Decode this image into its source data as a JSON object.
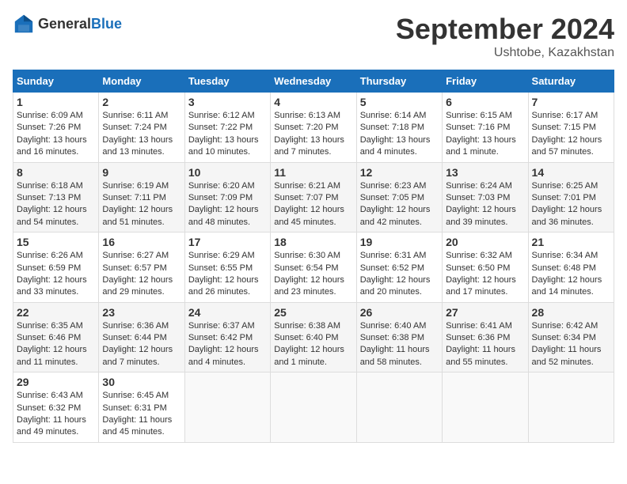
{
  "header": {
    "logo_general": "General",
    "logo_blue": "Blue",
    "month": "September 2024",
    "location": "Ushtobe, Kazakhstan"
  },
  "weekdays": [
    "Sunday",
    "Monday",
    "Tuesday",
    "Wednesday",
    "Thursday",
    "Friday",
    "Saturday"
  ],
  "weeks": [
    [
      {
        "day": "1",
        "sunrise": "Sunrise: 6:09 AM",
        "sunset": "Sunset: 7:26 PM",
        "daylight": "Daylight: 13 hours and 16 minutes."
      },
      {
        "day": "2",
        "sunrise": "Sunrise: 6:11 AM",
        "sunset": "Sunset: 7:24 PM",
        "daylight": "Daylight: 13 hours and 13 minutes."
      },
      {
        "day": "3",
        "sunrise": "Sunrise: 6:12 AM",
        "sunset": "Sunset: 7:22 PM",
        "daylight": "Daylight: 13 hours and 10 minutes."
      },
      {
        "day": "4",
        "sunrise": "Sunrise: 6:13 AM",
        "sunset": "Sunset: 7:20 PM",
        "daylight": "Daylight: 13 hours and 7 minutes."
      },
      {
        "day": "5",
        "sunrise": "Sunrise: 6:14 AM",
        "sunset": "Sunset: 7:18 PM",
        "daylight": "Daylight: 13 hours and 4 minutes."
      },
      {
        "day": "6",
        "sunrise": "Sunrise: 6:15 AM",
        "sunset": "Sunset: 7:16 PM",
        "daylight": "Daylight: 13 hours and 1 minute."
      },
      {
        "day": "7",
        "sunrise": "Sunrise: 6:17 AM",
        "sunset": "Sunset: 7:15 PM",
        "daylight": "Daylight: 12 hours and 57 minutes."
      }
    ],
    [
      {
        "day": "8",
        "sunrise": "Sunrise: 6:18 AM",
        "sunset": "Sunset: 7:13 PM",
        "daylight": "Daylight: 12 hours and 54 minutes."
      },
      {
        "day": "9",
        "sunrise": "Sunrise: 6:19 AM",
        "sunset": "Sunset: 7:11 PM",
        "daylight": "Daylight: 12 hours and 51 minutes."
      },
      {
        "day": "10",
        "sunrise": "Sunrise: 6:20 AM",
        "sunset": "Sunset: 7:09 PM",
        "daylight": "Daylight: 12 hours and 48 minutes."
      },
      {
        "day": "11",
        "sunrise": "Sunrise: 6:21 AM",
        "sunset": "Sunset: 7:07 PM",
        "daylight": "Daylight: 12 hours and 45 minutes."
      },
      {
        "day": "12",
        "sunrise": "Sunrise: 6:23 AM",
        "sunset": "Sunset: 7:05 PM",
        "daylight": "Daylight: 12 hours and 42 minutes."
      },
      {
        "day": "13",
        "sunrise": "Sunrise: 6:24 AM",
        "sunset": "Sunset: 7:03 PM",
        "daylight": "Daylight: 12 hours and 39 minutes."
      },
      {
        "day": "14",
        "sunrise": "Sunrise: 6:25 AM",
        "sunset": "Sunset: 7:01 PM",
        "daylight": "Daylight: 12 hours and 36 minutes."
      }
    ],
    [
      {
        "day": "15",
        "sunrise": "Sunrise: 6:26 AM",
        "sunset": "Sunset: 6:59 PM",
        "daylight": "Daylight: 12 hours and 33 minutes."
      },
      {
        "day": "16",
        "sunrise": "Sunrise: 6:27 AM",
        "sunset": "Sunset: 6:57 PM",
        "daylight": "Daylight: 12 hours and 29 minutes."
      },
      {
        "day": "17",
        "sunrise": "Sunrise: 6:29 AM",
        "sunset": "Sunset: 6:55 PM",
        "daylight": "Daylight: 12 hours and 26 minutes."
      },
      {
        "day": "18",
        "sunrise": "Sunrise: 6:30 AM",
        "sunset": "Sunset: 6:54 PM",
        "daylight": "Daylight: 12 hours and 23 minutes."
      },
      {
        "day": "19",
        "sunrise": "Sunrise: 6:31 AM",
        "sunset": "Sunset: 6:52 PM",
        "daylight": "Daylight: 12 hours and 20 minutes."
      },
      {
        "day": "20",
        "sunrise": "Sunrise: 6:32 AM",
        "sunset": "Sunset: 6:50 PM",
        "daylight": "Daylight: 12 hours and 17 minutes."
      },
      {
        "day": "21",
        "sunrise": "Sunrise: 6:34 AM",
        "sunset": "Sunset: 6:48 PM",
        "daylight": "Daylight: 12 hours and 14 minutes."
      }
    ],
    [
      {
        "day": "22",
        "sunrise": "Sunrise: 6:35 AM",
        "sunset": "Sunset: 6:46 PM",
        "daylight": "Daylight: 12 hours and 11 minutes."
      },
      {
        "day": "23",
        "sunrise": "Sunrise: 6:36 AM",
        "sunset": "Sunset: 6:44 PM",
        "daylight": "Daylight: 12 hours and 7 minutes."
      },
      {
        "day": "24",
        "sunrise": "Sunrise: 6:37 AM",
        "sunset": "Sunset: 6:42 PM",
        "daylight": "Daylight: 12 hours and 4 minutes."
      },
      {
        "day": "25",
        "sunrise": "Sunrise: 6:38 AM",
        "sunset": "Sunset: 6:40 PM",
        "daylight": "Daylight: 12 hours and 1 minute."
      },
      {
        "day": "26",
        "sunrise": "Sunrise: 6:40 AM",
        "sunset": "Sunset: 6:38 PM",
        "daylight": "Daylight: 11 hours and 58 minutes."
      },
      {
        "day": "27",
        "sunrise": "Sunrise: 6:41 AM",
        "sunset": "Sunset: 6:36 PM",
        "daylight": "Daylight: 11 hours and 55 minutes."
      },
      {
        "day": "28",
        "sunrise": "Sunrise: 6:42 AM",
        "sunset": "Sunset: 6:34 PM",
        "daylight": "Daylight: 11 hours and 52 minutes."
      }
    ],
    [
      {
        "day": "29",
        "sunrise": "Sunrise: 6:43 AM",
        "sunset": "Sunset: 6:32 PM",
        "daylight": "Daylight: 11 hours and 49 minutes."
      },
      {
        "day": "30",
        "sunrise": "Sunrise: 6:45 AM",
        "sunset": "Sunset: 6:31 PM",
        "daylight": "Daylight: 11 hours and 45 minutes."
      },
      null,
      null,
      null,
      null,
      null
    ]
  ]
}
